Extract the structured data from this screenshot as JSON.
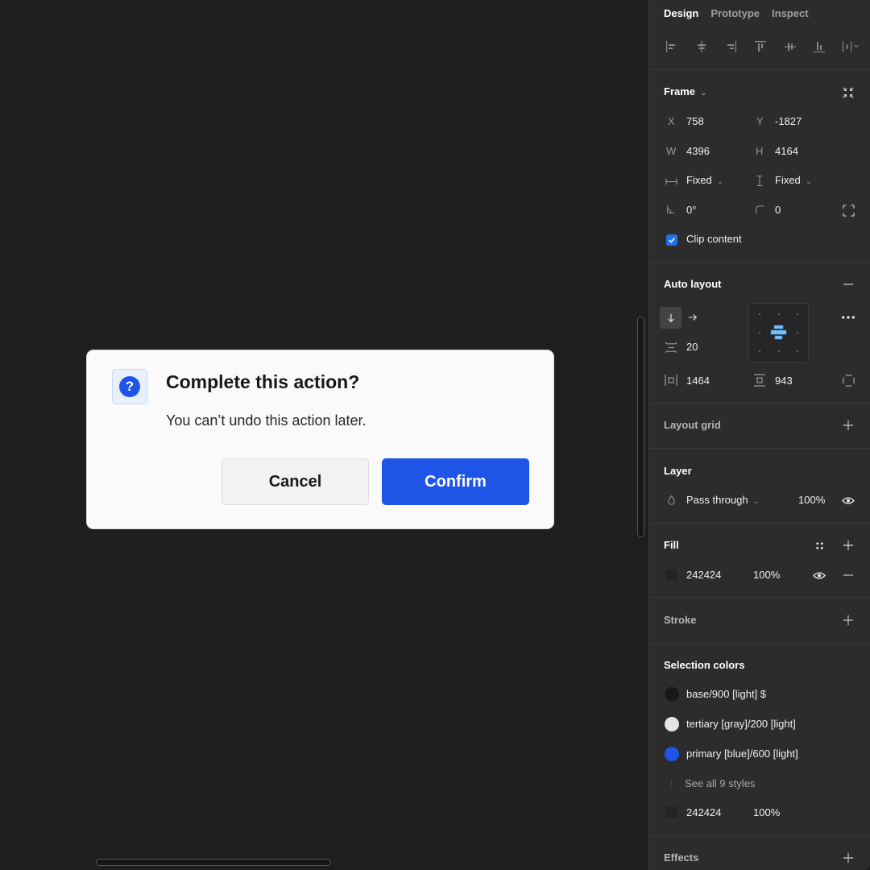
{
  "canvas": {
    "dialog": {
      "icon": "question-icon",
      "icon_glyph": "?",
      "title": "Complete this action?",
      "body": "You can’t undo this action later.",
      "cancel_label": "Cancel",
      "confirm_label": "Confirm"
    },
    "colors": {
      "background": "#1e1e1e",
      "dialog_bg": "#fafafa",
      "primary": "#1f55e6"
    }
  },
  "panel": {
    "tabs": [
      {
        "label": "Design",
        "active": true
      },
      {
        "label": "Prototype",
        "active": false
      },
      {
        "label": "Inspect",
        "active": false
      }
    ],
    "alignment_icons": [
      "align-left-icon",
      "align-horizontal-center-icon",
      "align-right-icon",
      "align-top-icon",
      "align-vertical-center-icon",
      "align-bottom-icon",
      "distribute-icon"
    ],
    "frame": {
      "title": "Frame",
      "x_label": "X",
      "x": "758",
      "y_label": "Y",
      "y": "-1827",
      "w_label": "W",
      "w": "4396",
      "h_label": "H",
      "h": "4164",
      "horizontal_resizing": "Fixed",
      "vertical_resizing": "Fixed",
      "rotation": "0°",
      "corner_radius": "0",
      "clip_content_label": "Clip content",
      "clip_content": true
    },
    "auto_layout": {
      "title": "Auto layout",
      "direction": "vertical",
      "spacing": "20",
      "horizontal_padding": "1464",
      "vertical_padding": "943",
      "alignment": "center"
    },
    "layout_grid": {
      "title": "Layout grid"
    },
    "layer": {
      "title": "Layer",
      "blend_mode": "Pass through",
      "opacity": "100%"
    },
    "fill": {
      "title": "Fill",
      "hex": "242424",
      "opacity": "100%",
      "swatch_color": "#242424"
    },
    "stroke": {
      "title": "Stroke"
    },
    "selection_colors": {
      "title": "Selection colors",
      "items": [
        {
          "label": "base/900 [light] $",
          "color": "#18181b"
        },
        {
          "label": "tertiary [gray]/200 [light]",
          "color": "#e4e4e7"
        },
        {
          "label": "primary [blue]/600 [light]",
          "color": "#1f55e6"
        }
      ],
      "see_all_label": "See all 9 styles",
      "extra": {
        "hex": "242424",
        "opacity": "100%",
        "color": "#242424"
      }
    },
    "effects": {
      "title": "Effects"
    }
  }
}
